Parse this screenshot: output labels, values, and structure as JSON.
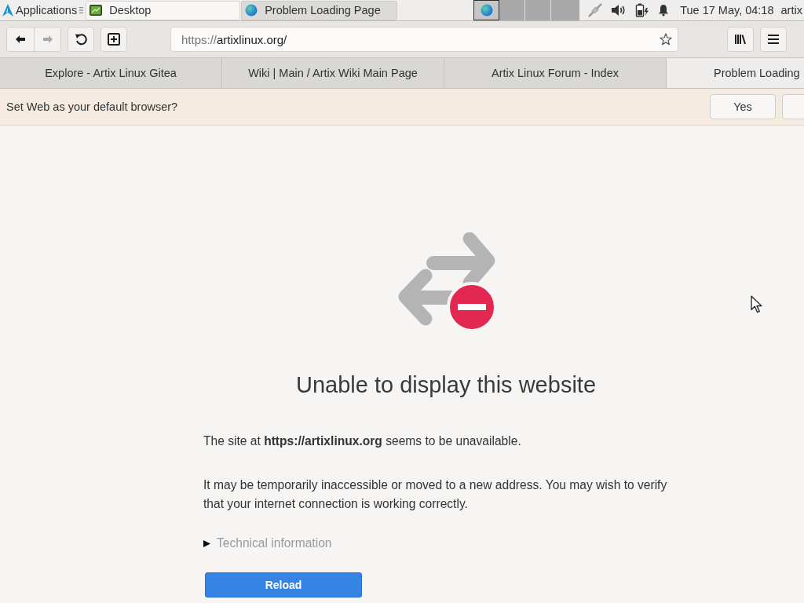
{
  "panel": {
    "app_menu": {
      "label": "Applications"
    },
    "tasks": [
      {
        "label": "Desktop",
        "kind": "desktop",
        "selected": false
      },
      {
        "label": "Problem Loading Page",
        "kind": "browser",
        "selected": true
      }
    ],
    "workspaces": [
      {
        "selected": true,
        "occupied": true
      },
      {
        "selected": false,
        "occupied": false
      },
      {
        "selected": false,
        "occupied": false
      },
      {
        "selected": false,
        "occupied": false
      }
    ],
    "tray": [
      {
        "kind": "network"
      },
      {
        "kind": "volume"
      },
      {
        "kind": "battery"
      },
      {
        "kind": "notifications"
      }
    ],
    "clock": "Tue 17 May, 04:18",
    "user": "artix"
  },
  "toolbar": {
    "back": {
      "disabled": false
    },
    "forward": {
      "disabled": true
    },
    "url": {
      "scheme": "https://",
      "host": "artixlinux.org/"
    }
  },
  "tabs": [
    {
      "label": "Explore - Artix Linux Gitea",
      "selected": false
    },
    {
      "label": "Wiki | Main / Artix Wiki Main Page",
      "selected": false
    },
    {
      "label": "Artix Linux Forum - Index",
      "selected": false
    },
    {
      "label": "Problem Loading",
      "selected": true
    }
  ],
  "infobar": {
    "message": "Set Web as your default browser?",
    "buttons": [
      "Yes"
    ]
  },
  "error_page": {
    "title": "Unable to display this website",
    "paragraphs": [
      "The site at **https://artixlinux.org** seems to be unavailable.",
      "It may be temporarily inaccessible or moved to a new address. You may wish to verify that your internet connection is working correctly."
    ],
    "details": {
      "label": "Technical information",
      "expanded": false
    },
    "button": "Reload"
  }
}
